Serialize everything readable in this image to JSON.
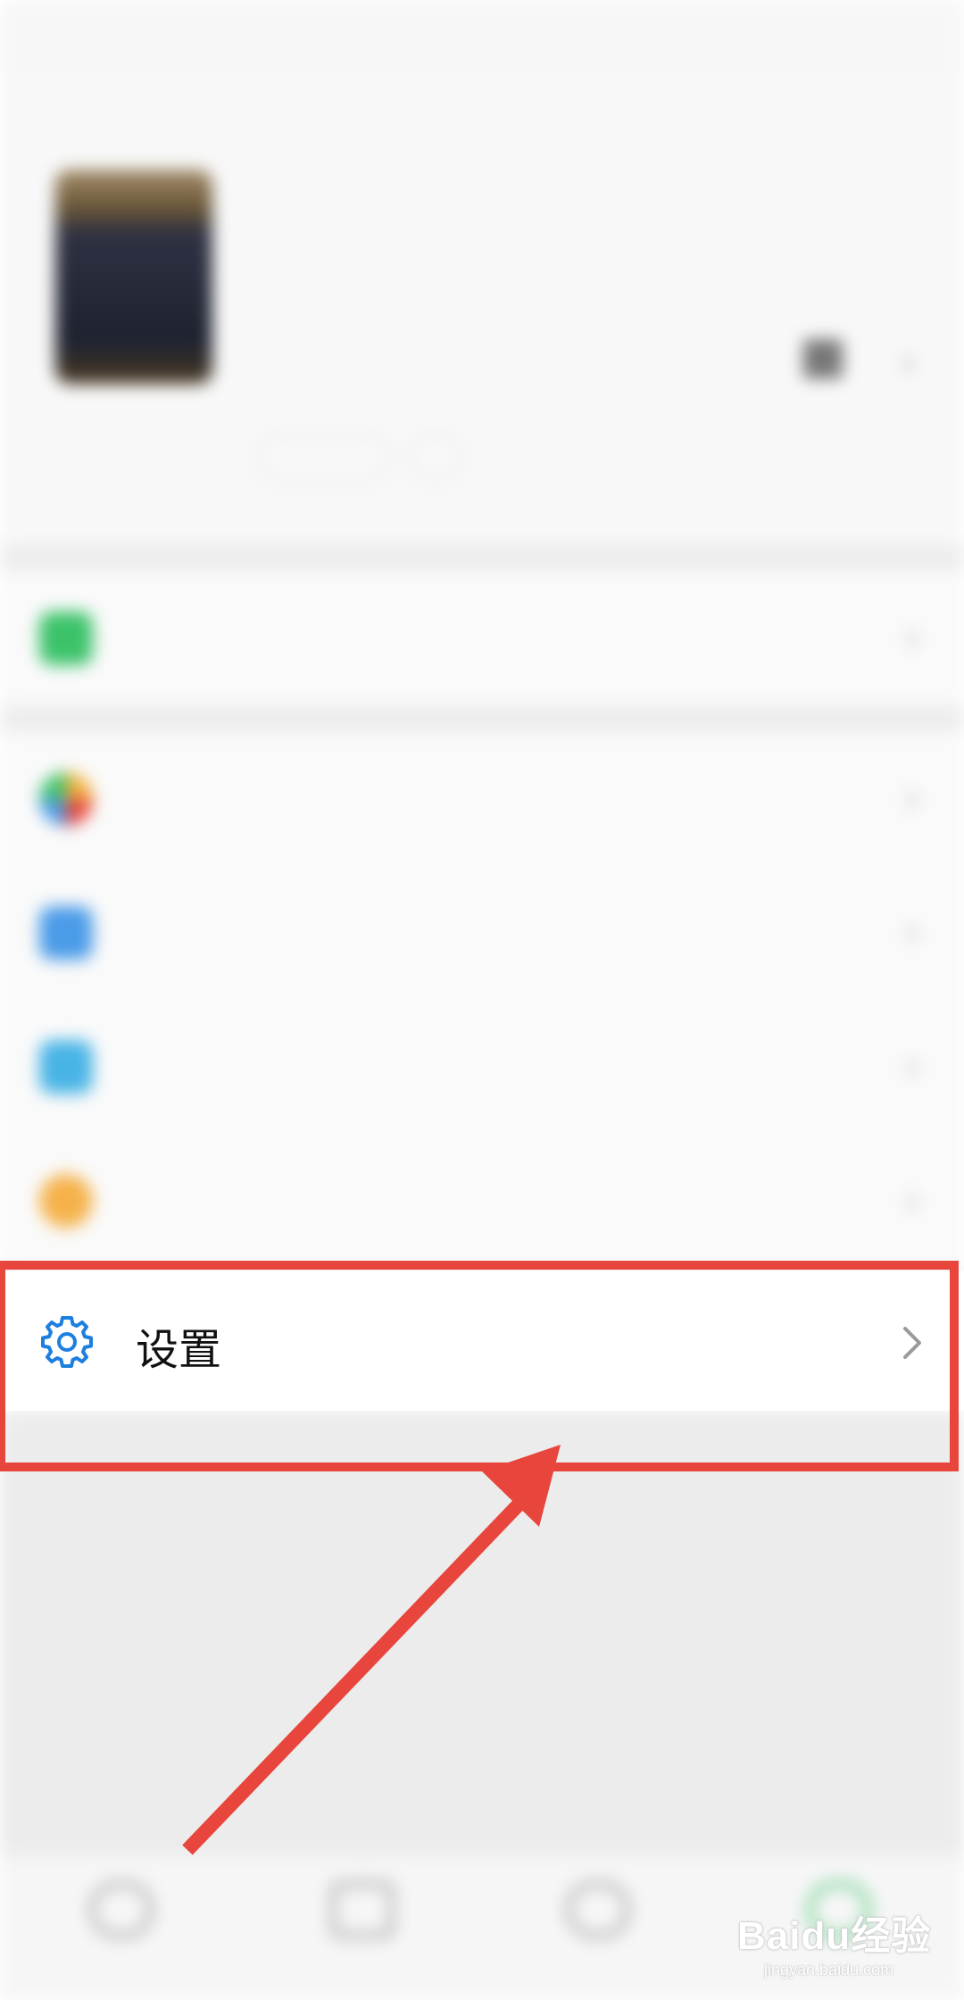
{
  "status_bar": {
    "left_text": "",
    "right_text": ""
  },
  "profile": {
    "nickname": "",
    "wechat_id": "",
    "status_label": ""
  },
  "menu": {
    "items": [
      {
        "label": "",
        "icon": "pay-icon",
        "color": "#3cc36a"
      },
      {
        "label": "",
        "icon": "favorites-icon",
        "color": "#f3b13b"
      },
      {
        "label": "",
        "icon": "moments-icon",
        "color": "#4a9be8"
      },
      {
        "label": "",
        "icon": "cards-icon",
        "color": "#48b4e6"
      },
      {
        "label": "",
        "icon": "stickers-icon",
        "color": "#f5b24a"
      }
    ],
    "settings": {
      "label": "设置",
      "icon": "gear-icon",
      "color": "#1d7fe0"
    }
  },
  "tabbar": {
    "tabs": [
      {
        "label": "",
        "icon": "chats-icon"
      },
      {
        "label": "",
        "icon": "contacts-icon"
      },
      {
        "label": "",
        "icon": "discover-icon"
      },
      {
        "label": "",
        "icon": "me-icon",
        "active_color": "#3cc36a"
      }
    ]
  },
  "annotation": {
    "highlight_color": "#e8453c",
    "target": "settings"
  },
  "watermark": {
    "main": "Baidu经验",
    "sub": "jingyan.baidu.com"
  }
}
